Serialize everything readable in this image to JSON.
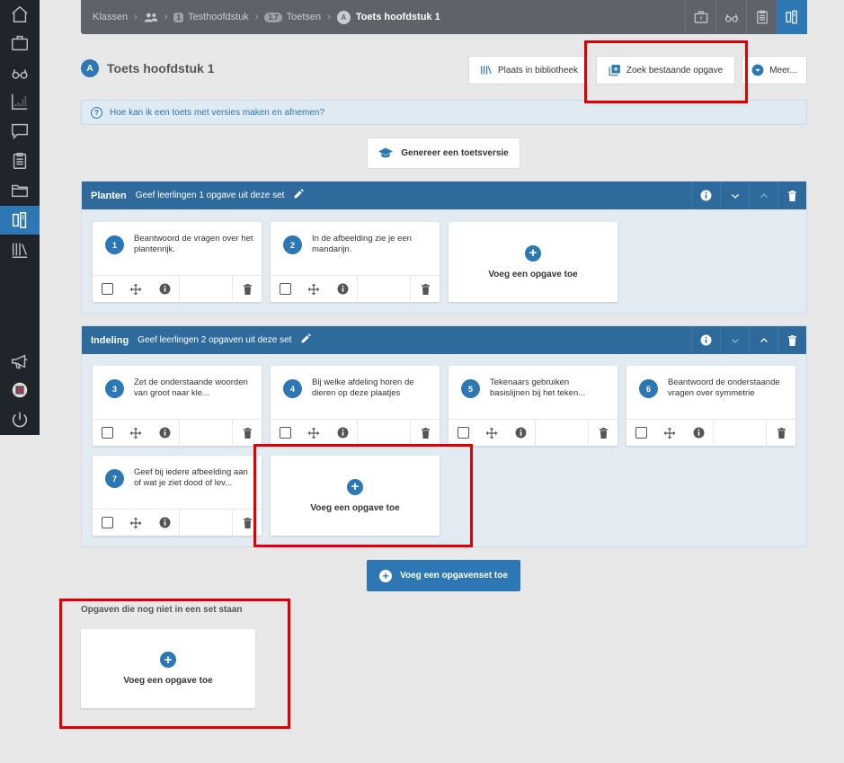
{
  "breadcrumb": {
    "klassen": "Klassen",
    "chapter_badge": "1",
    "chapter": "Testhoofdstuk",
    "tests_badge": "1.7",
    "tests": "Toetsen",
    "current_badge": "A",
    "current": "Toets hoofdstuk 1"
  },
  "page": {
    "title_badge": "A",
    "title": "Toets hoofdstuk 1"
  },
  "actions": {
    "library": "Plaats in bibliotheek",
    "search": "Zoek bestaande opgave",
    "more": "Meer..."
  },
  "help": {
    "text": "Hoe kan ik een toets met versies maken en afnemen?"
  },
  "generate": {
    "label": "Genereer een toetsversie"
  },
  "sets": [
    {
      "name": "Planten",
      "desc": "Geef leerlingen 1 opgave uit deze set",
      "items": [
        {
          "num": "1",
          "text": "Beantwoord de vragen over het plantenrijk."
        },
        {
          "num": "2",
          "text": "In de afbeelding zie je een mandarijn."
        }
      ]
    },
    {
      "name": "Indeling",
      "desc": "Geef leerlingen 2 opgaven uit deze set",
      "items": [
        {
          "num": "3",
          "text": "Zet de onderstaande woorden van groot naar kle..."
        },
        {
          "num": "4",
          "text": "Bij welke afdeling horen de dieren op deze plaatjes"
        },
        {
          "num": "5",
          "text": "Tekenaars gebruiken basislijnen bij het teken..."
        },
        {
          "num": "6",
          "text": "Beantwoord de onderstaande vragen over symmetrie"
        },
        {
          "num": "7",
          "text": "Geef bij iedere afbeelding aan of wat je ziet dood of lev..."
        }
      ]
    }
  ],
  "add_item_label": "Voeg een opgave toe",
  "add_set_label": "Voeg een opgavenset toe",
  "loose": {
    "title": "Opgaven die nog niet in een set staan"
  },
  "colors": {
    "accent": "#2d78b4",
    "set_header": "#2e6a9c",
    "sidebar": "#1f252b",
    "highlight": "#e00000"
  }
}
